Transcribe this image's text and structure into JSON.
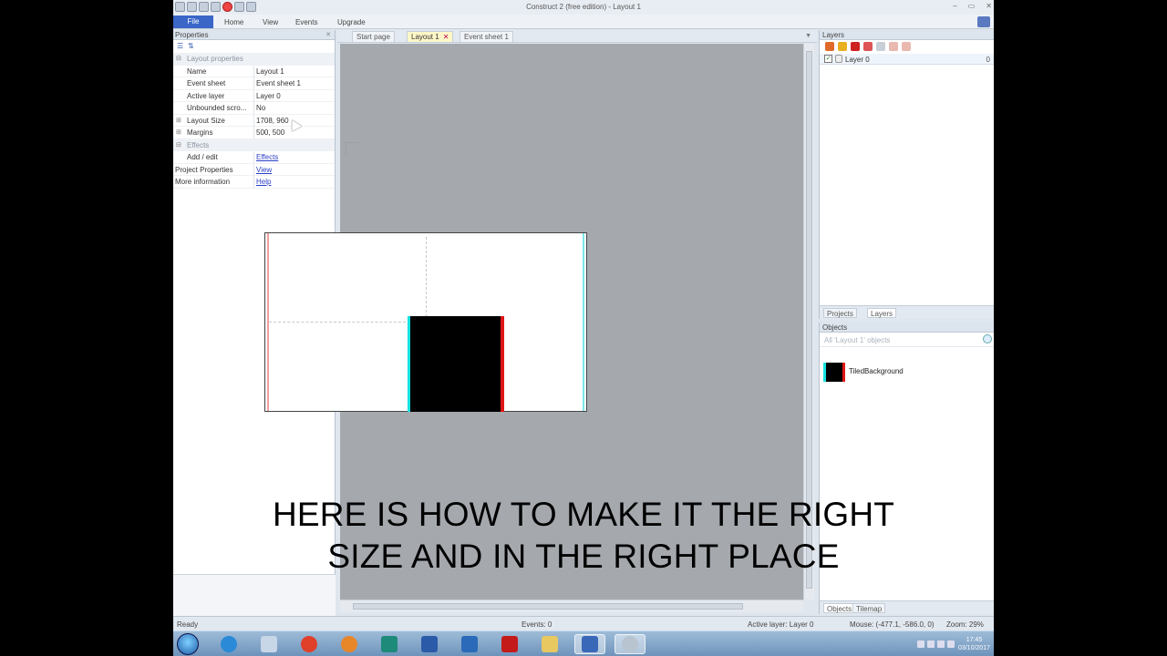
{
  "window": {
    "title": "Construct 2 (free edition) - Layout 1"
  },
  "ribbon": {
    "tabs": [
      "File",
      "Home",
      "View",
      "Events",
      "Upgrade"
    ]
  },
  "properties": {
    "title": "Properties",
    "rows": [
      {
        "key": "Layout properties",
        "value": "",
        "kind": "category"
      },
      {
        "key": "Name",
        "value": "Layout 1"
      },
      {
        "key": "Event sheet",
        "value": "Event sheet 1"
      },
      {
        "key": "Active layer",
        "value": "Layer 0"
      },
      {
        "key": "Unbounded scro...",
        "value": "No"
      },
      {
        "key": "Layout Size",
        "value": "1708, 960",
        "expand": "⊞"
      },
      {
        "key": "Margins",
        "value": "500, 500",
        "expand": "⊞"
      },
      {
        "key": "Effects",
        "value": "",
        "kind": "category"
      },
      {
        "key": "Add / edit",
        "value": "Effects",
        "link": true
      },
      {
        "key": "Project Properties",
        "value": "View",
        "link": true,
        "top": true
      },
      {
        "key": "More information",
        "value": "Help",
        "link": true,
        "top": true
      }
    ]
  },
  "editor": {
    "tabs": [
      {
        "label": "Start page"
      },
      {
        "label": "Layout 1",
        "active": true
      },
      {
        "label": "Event sheet 1"
      }
    ]
  },
  "layers": {
    "title": "Layers",
    "items": [
      {
        "name": "Layer 0",
        "index": "0",
        "visible": true
      }
    ]
  },
  "project_tabs": [
    "Projects",
    "Layers"
  ],
  "objects": {
    "title": "Objects",
    "search_placeholder": "All 'Layout 1' objects",
    "items": [
      {
        "name": "TiledBackground"
      }
    ]
  },
  "object_tabs": [
    "Objects",
    "Tilemap"
  ],
  "status": {
    "ready": "Ready",
    "events": "Events: 0",
    "active_layer": "Active layer: Layer 0",
    "mouse": "Mouse: (-477.1, -586.0, 0)",
    "zoom": "Zoom: 29%"
  },
  "caption": {
    "line1": "HERE IS HOW TO MAKE IT THE RIGHT",
    "line2": "SIZE AND IN THE RIGHT PLACE"
  },
  "taskbar": {
    "time": "17:45",
    "date": "03/10/2017"
  },
  "colors": {
    "accent": "#3a66c8",
    "canvas": "#a5a9ae",
    "object_fill": "#000000"
  }
}
